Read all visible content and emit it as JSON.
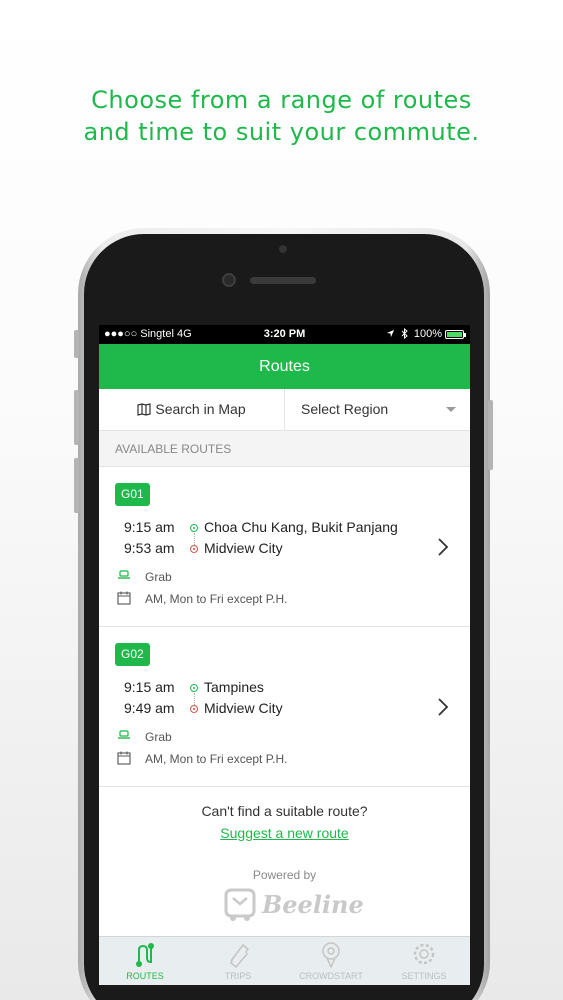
{
  "headline": {
    "line1": "Choose from a range of routes",
    "line2": "and time to suit your commute."
  },
  "status_bar": {
    "carrier": "●●●○○ Singtel  4G",
    "time": "3:20 PM",
    "battery": "100%",
    "battery_level": 1.0,
    "icons": [
      "location-arrow-icon",
      "bluetooth-icon",
      "battery-icon"
    ]
  },
  "nav": {
    "title": "Routes"
  },
  "filters": {
    "search_map_label": "Search in Map",
    "search_map_icon": "map-icon",
    "region_label": "Select Region"
  },
  "section": {
    "header": "AVAILABLE ROUTES"
  },
  "routes": [
    {
      "code": "G01",
      "stops": [
        {
          "time": "9:15 am",
          "name": "Choa Chu Kang, Bukit Panjang"
        },
        {
          "time": "9:53 am",
          "name": "Midview City"
        }
      ],
      "operator": "Grab",
      "schedule": "AM, Mon to Fri except P.H."
    },
    {
      "code": "G02",
      "stops": [
        {
          "time": "9:15 am",
          "name": "Tampines"
        },
        {
          "time": "9:49 am",
          "name": "Midview City"
        }
      ],
      "operator": "Grab",
      "schedule": "AM, Mon to Fri except P.H."
    }
  ],
  "footer": {
    "prompt": "Can't find a suitable route?",
    "link": "Suggest a new route",
    "powered_by": "Powered by",
    "brand": "Beeline"
  },
  "tabs": [
    {
      "label": "ROUTES",
      "icon": "route-icon",
      "active": true
    },
    {
      "label": "TRIPS",
      "icon": "ticket-icon",
      "active": false
    },
    {
      "label": "CROWDSTART",
      "icon": "crowdstart-pin-icon",
      "active": false
    },
    {
      "label": "SETTINGS",
      "icon": "gear-icon",
      "active": false
    }
  ],
  "colors": {
    "brand_green": "#1fb84a",
    "destination_red": "#d9534f",
    "tab_inactive": "#bdbdbd"
  }
}
